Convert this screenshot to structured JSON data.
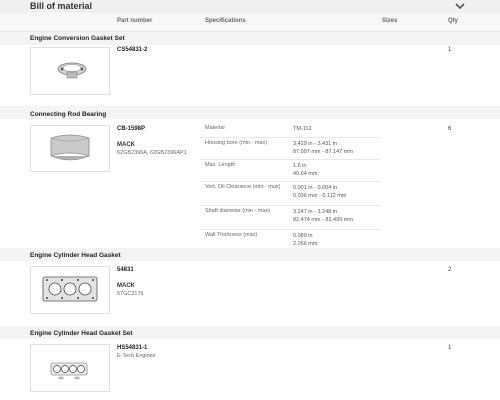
{
  "header": {
    "title": "Bill of material"
  },
  "columns": {
    "part_number": "Part number",
    "specifications": "Specifications",
    "sizes": "Sizes",
    "qty": "Qty"
  },
  "items": [
    {
      "section": "Engine Conversion Gasket Set",
      "part_number": "CS54831-2",
      "qty": "1"
    },
    {
      "section": "Connecting Rod Bearing",
      "part_number": "CB-1598P",
      "brand": "MACK",
      "alt_numbers": "62GB2396A, 62GB2396AP1",
      "qty": "6",
      "specs": [
        {
          "label": "Material",
          "value1": "TM-112",
          "value2": ""
        },
        {
          "label": "Housing bore (min - max)",
          "value1": "3.429 in - 3.431 in",
          "value2": "87.097 mm - 87.147 mm"
        },
        {
          "label": "Max. Length",
          "value1": "1.6 in",
          "value2": "40.64 mm"
        },
        {
          "label": "Vert. Oil Clearance (min - max)",
          "value1": "0.001 in - 0.004 in",
          "value2": "0.036 mm - 0.112 mm"
        },
        {
          "label": "Shaft diameter (min - max)",
          "value1": "3.247 in - 3.248 in",
          "value2": "82.474 mm - 82.499 mm"
        },
        {
          "label": "Wall Thickness (max)",
          "value1": "0.089 in",
          "value2": "2.266 mm"
        }
      ]
    },
    {
      "section": "Engine Cylinder Head Gasket",
      "part_number": "54831",
      "brand": "MACK",
      "alt_numbers": "57GC2176",
      "qty": "2"
    },
    {
      "section": "Engine Cylinder Head Gasket Set",
      "part_number": "HS54831-1",
      "note": "E-Tech Engines",
      "qty": "1"
    }
  ],
  "icons": {
    "collapse": "chevron-down-icon"
  },
  "colors": {
    "band": "#f4f4f4",
    "header_bg": "#f0f0f0"
  }
}
